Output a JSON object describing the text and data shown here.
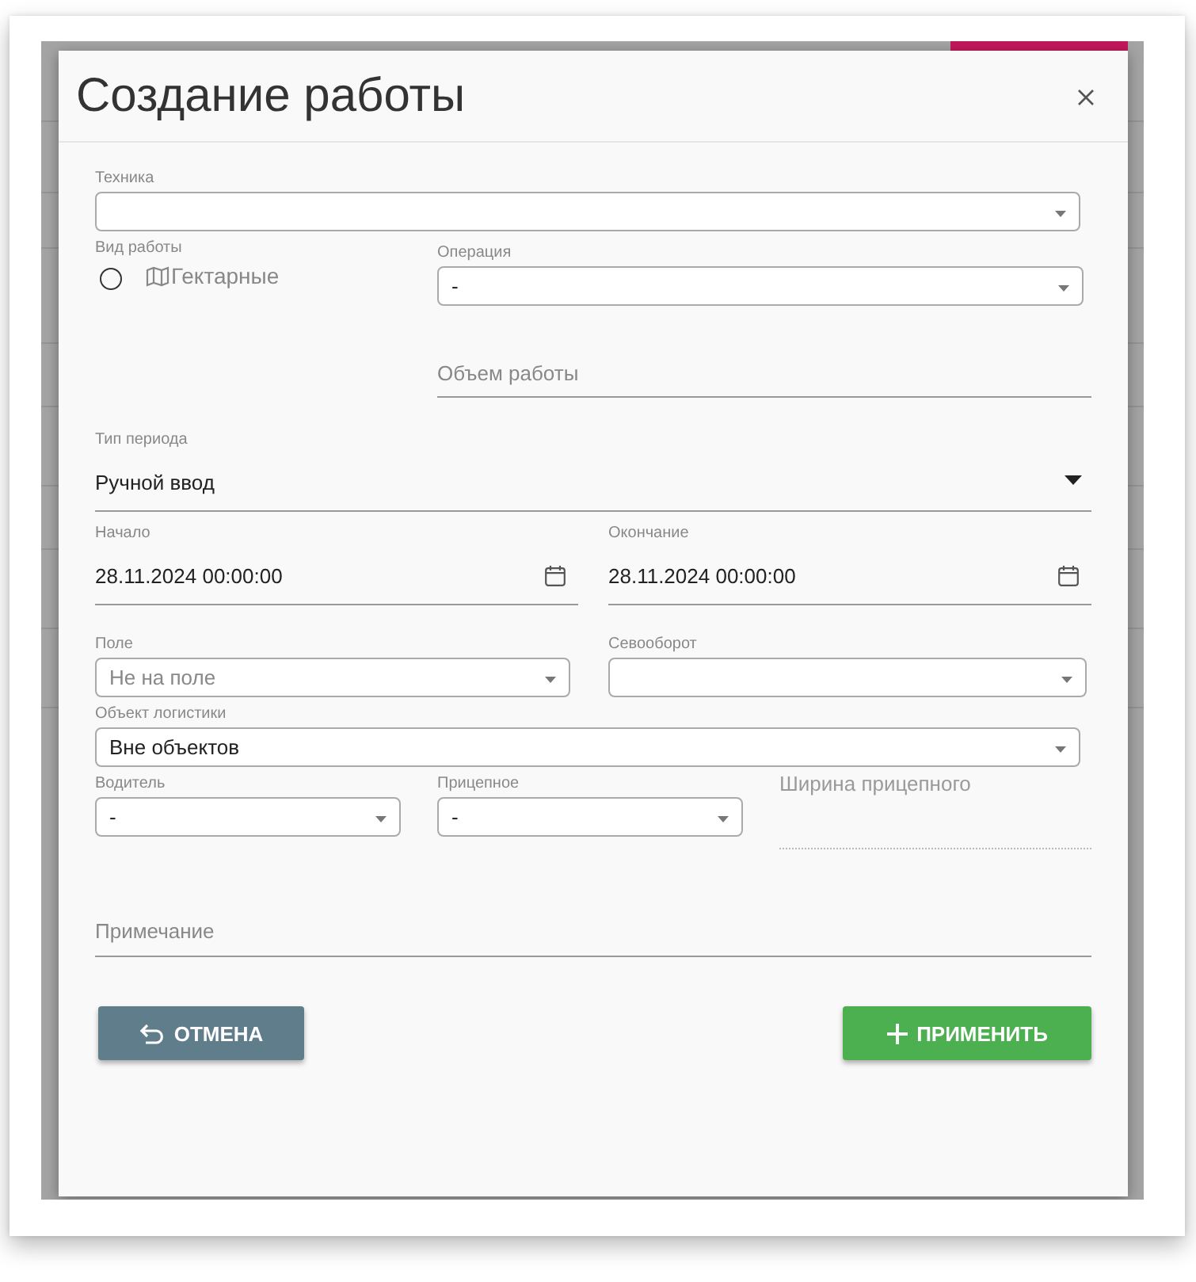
{
  "dialog": {
    "title": "Создание работы"
  },
  "technique": {
    "label": "Техника"
  },
  "work_type": {
    "label": "Вид работы",
    "options": [
      {
        "label": "Гектарные",
        "selected": false
      }
    ]
  },
  "operation": {
    "label": "Операция",
    "value": "-"
  },
  "work_volume": {
    "placeholder": "Объем работы"
  },
  "period_type": {
    "label": "Тип периода",
    "value": "Ручной ввод"
  },
  "start": {
    "label": "Начало",
    "value": "28.11.2024 00:00:00"
  },
  "end": {
    "label": "Окончание",
    "value": "28.11.2024 00:00:00"
  },
  "field": {
    "label": "Поле",
    "placeholder": "Не на поле"
  },
  "crop_rotation": {
    "label": "Севооборот"
  },
  "logistics_object": {
    "label": "Объект логистики",
    "value": "Вне объектов"
  },
  "driver": {
    "label": "Водитель",
    "value": "-"
  },
  "trailer": {
    "label": "Прицепное",
    "value": "-"
  },
  "trailer_width": {
    "placeholder": "Ширина прицепного",
    "disabled": true
  },
  "note": {
    "placeholder": "Примечание"
  },
  "buttons": [
    {
      "label": "ОТМЕНА",
      "kind": "cancel"
    },
    {
      "label": "ПРИМЕНИТЬ",
      "kind": "apply"
    }
  ]
}
